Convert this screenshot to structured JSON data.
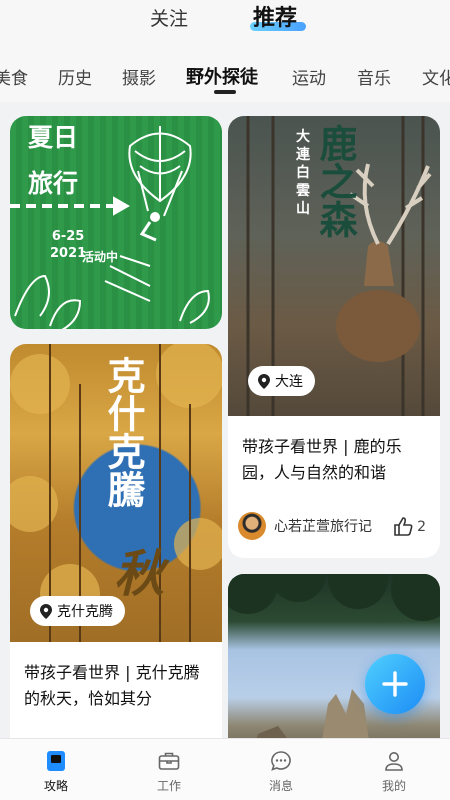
{
  "top_tabs": {
    "follow": "关注",
    "recommend": "推荐"
  },
  "categories": [
    "美食",
    "历史",
    "摄影",
    "野外探徒",
    "运动",
    "音乐",
    "文化"
  ],
  "active_category": "野外探徒",
  "cards": {
    "summer": {
      "title_line1": "夏日",
      "title_line2": "旅行",
      "date": "6-25\n2021",
      "status": "活动中"
    },
    "deer": {
      "poster_title": "鹿之森",
      "poster_sub": "大連白雲山",
      "location": "大连",
      "title": "带孩子看世界 | 鹿的乐园，人与自然的和谐",
      "author": "心若芷萱旅行记",
      "likes": "2"
    },
    "autumn": {
      "poster_title": "克什克騰",
      "poster_title2": "秋",
      "location": "克什克腾",
      "title": "带孩子看世界 | 克什克腾的秋天，恰如其分"
    }
  },
  "nav": [
    {
      "label": "攻略",
      "icon": "guide-icon"
    },
    {
      "label": "工作",
      "icon": "briefcase-icon"
    },
    {
      "label": "消息",
      "icon": "message-icon"
    },
    {
      "label": "我的",
      "icon": "profile-icon"
    }
  ],
  "colors": {
    "accent": "#1f8cff",
    "card_bg": "#ffffff",
    "page_bg": "#f1f2f4"
  }
}
